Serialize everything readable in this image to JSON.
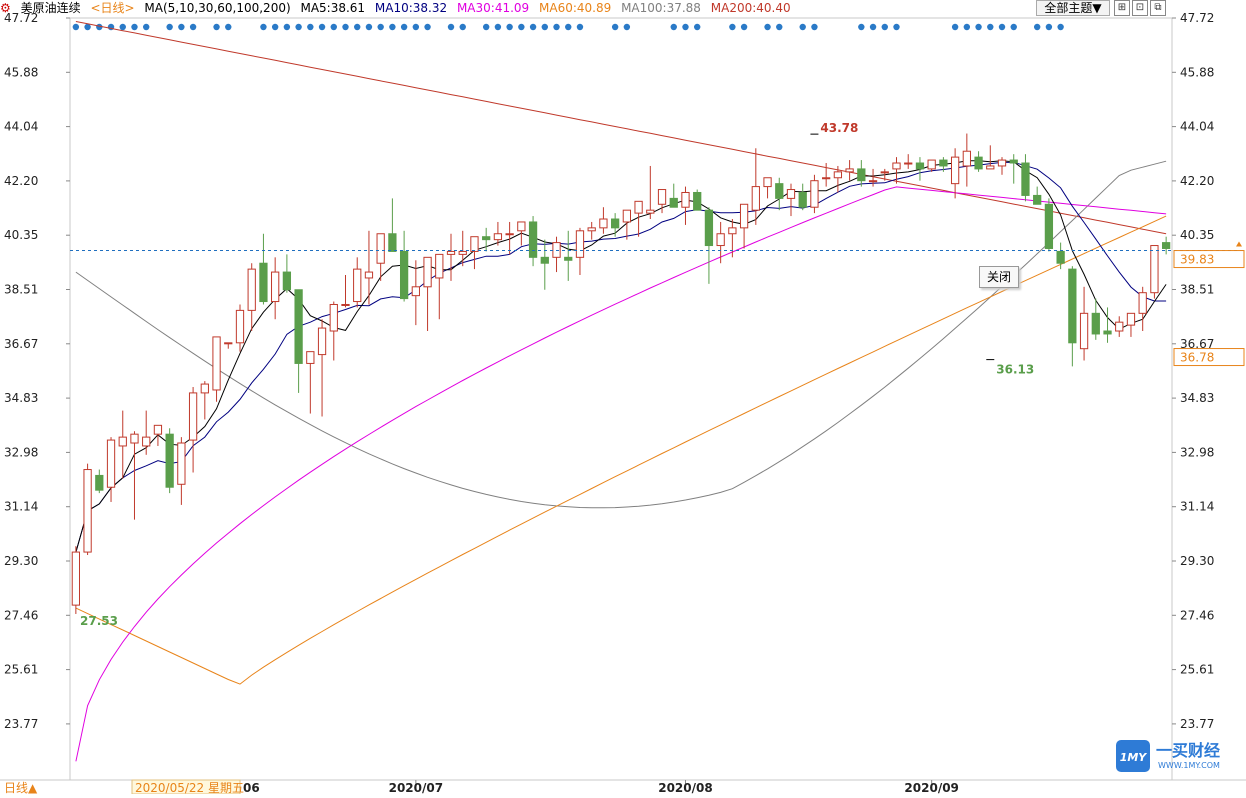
{
  "header": {
    "symbol": "美原油连续",
    "period_link": "<日线>",
    "ma_label": "MA(5,10,30,60,100,200)",
    "ma5": "MA5:38.61",
    "ma10": "MA10:38.32",
    "ma30": "MA30:41.09",
    "ma60": "MA60:40.89",
    "ma100": "MA100:37.88",
    "ma200": "MA200:40.40",
    "theme_button": "全部主题▼"
  },
  "overlay": {
    "close_label": "关闭",
    "high_label": "43.78",
    "low_label": "36.13",
    "start_low_label": "27.53",
    "price_tag_current": "39.83",
    "price_tag_ma": "36.78"
  },
  "footer": {
    "period_button": "日线▲",
    "cursor_date": "2020/05/22 星期五",
    "cursor_tail": "06"
  },
  "logo": {
    "name": "一买财经",
    "url": "WWW.1MY.COM",
    "badge": "1MY"
  },
  "colors": {
    "up": "#c0392b",
    "down": "#5a9e4b",
    "ma5": "#000000",
    "ma10": "#000080",
    "ma30": "#e000e0",
    "ma60": "#e8841a",
    "ma100": "#808080",
    "ma200": "#c0392b",
    "dash": "#1f6fbf"
  },
  "chart_data": {
    "type": "candlestick",
    "title": "美原油连续",
    "y_ticks": [
      "47.72",
      "45.88",
      "44.04",
      "42.20",
      "40.35",
      "38.51",
      "36.67",
      "34.83",
      "32.98",
      "31.14",
      "29.30",
      "27.46",
      "25.61",
      "23.77"
    ],
    "ylim": [
      22.5,
      47.72
    ],
    "x_labels": [
      {
        "label": "2020/07",
        "index": 29
      },
      {
        "label": "2020/08",
        "index": 52
      },
      {
        "label": "2020/09",
        "index": 73
      }
    ],
    "current_price": 39.83,
    "high_marker": {
      "index": 63,
      "value": 43.78
    },
    "low_marker": {
      "index": 78,
      "value": 36.13
    },
    "start_marker": {
      "index": 0,
      "value": 27.53
    },
    "candles": [
      [
        27.8,
        29.8,
        27.5,
        29.6
      ],
      [
        29.6,
        32.6,
        29.5,
        32.4
      ],
      [
        32.2,
        32.4,
        31.6,
        31.7
      ],
      [
        31.8,
        33.5,
        31.3,
        33.4
      ],
      [
        33.2,
        34.4,
        32.1,
        33.5
      ],
      [
        33.3,
        33.7,
        30.7,
        33.6
      ],
      [
        33.2,
        34.4,
        32.9,
        33.5
      ],
      [
        33.6,
        33.9,
        33.2,
        33.9
      ],
      [
        33.6,
        33.8,
        31.6,
        31.8
      ],
      [
        31.9,
        33.5,
        31.2,
        33.3
      ],
      [
        33.4,
        35.2,
        32.3,
        35.0
      ],
      [
        35.0,
        35.4,
        34.1,
        35.3
      ],
      [
        35.1,
        36.9,
        34.7,
        36.9
      ],
      [
        36.7,
        36.7,
        36.5,
        36.7
      ],
      [
        36.7,
        38.0,
        36.4,
        37.8
      ],
      [
        37.8,
        39.4,
        37.1,
        39.2
      ],
      [
        39.4,
        40.4,
        38.0,
        38.1
      ],
      [
        38.1,
        39.6,
        37.5,
        39.1
      ],
      [
        39.1,
        39.7,
        38.4,
        38.5
      ],
      [
        38.5,
        38.5,
        35.0,
        36.0
      ],
      [
        36.0,
        36.3,
        34.3,
        36.4
      ],
      [
        36.3,
        37.5,
        34.2,
        37.2
      ],
      [
        37.1,
        38.1,
        36.1,
        38.0
      ],
      [
        38.0,
        39.0,
        37.9,
        38.0
      ],
      [
        38.1,
        39.6,
        37.9,
        39.2
      ],
      [
        38.9,
        40.5,
        38.0,
        39.1
      ],
      [
        39.4,
        40.4,
        38.8,
        40.4
      ],
      [
        40.4,
        41.6,
        40.0,
        39.8
      ],
      [
        39.8,
        40.5,
        38.1,
        38.2
      ],
      [
        38.3,
        39.5,
        37.3,
        38.6
      ],
      [
        38.6,
        38.9,
        37.1,
        39.6
      ],
      [
        38.9,
        39.6,
        37.5,
        39.7
      ],
      [
        39.7,
        40.4,
        38.8,
        39.8
      ],
      [
        39.7,
        40.5,
        39.3,
        39.8
      ],
      [
        39.8,
        40.1,
        39.2,
        40.3
      ],
      [
        40.3,
        40.6,
        39.8,
        40.2
      ],
      [
        40.2,
        40.8,
        40.0,
        40.4
      ],
      [
        40.4,
        40.8,
        39.7,
        40.4
      ],
      [
        40.5,
        40.7,
        40.0,
        40.8
      ],
      [
        40.8,
        41.0,
        39.3,
        39.6
      ],
      [
        39.6,
        40.2,
        38.5,
        39.4
      ],
      [
        39.6,
        40.3,
        39.1,
        40.1
      ],
      [
        39.6,
        40.5,
        38.8,
        39.5
      ],
      [
        39.6,
        40.6,
        39.0,
        40.5
      ],
      [
        40.5,
        40.8,
        40.2,
        40.6
      ],
      [
        40.6,
        41.3,
        40.4,
        40.9
      ],
      [
        40.9,
        41.1,
        40.3,
        40.6
      ],
      [
        40.8,
        41.2,
        40.2,
        41.2
      ],
      [
        41.1,
        41.2,
        40.3,
        41.5
      ],
      [
        41.1,
        42.7,
        40.9,
        41.2
      ],
      [
        41.4,
        41.9,
        41.1,
        41.9
      ],
      [
        41.6,
        42.1,
        41.3,
        41.3
      ],
      [
        41.3,
        42.0,
        40.7,
        41.8
      ],
      [
        41.8,
        41.9,
        41.2,
        41.2
      ],
      [
        41.2,
        41.3,
        38.7,
        40.0
      ],
      [
        40.0,
        40.8,
        39.4,
        40.4
      ],
      [
        40.4,
        40.9,
        39.6,
        40.6
      ],
      [
        40.6,
        41.4,
        39.9,
        41.4
      ],
      [
        41.2,
        43.3,
        40.7,
        42.0
      ],
      [
        42.0,
        42.3,
        41.6,
        42.3
      ],
      [
        42.1,
        42.3,
        41.2,
        41.6
      ],
      [
        41.6,
        42.1,
        41.0,
        41.9
      ],
      [
        41.8,
        42.1,
        41.2,
        41.3
      ],
      [
        41.3,
        42.4,
        41.1,
        42.2
      ],
      [
        42.3,
        42.8,
        42.0,
        42.3
      ]
    ],
    "candles_tail": [
      [
        42.3,
        42.7,
        41.8,
        42.5
      ],
      [
        42.5,
        42.9,
        42.2,
        42.6
      ],
      [
        42.6,
        42.9,
        42.0,
        42.2
      ],
      [
        42.2,
        42.6,
        42.0,
        42.2
      ],
      [
        42.5,
        42.6,
        42.2,
        42.5
      ],
      [
        42.6,
        43.0,
        42.1,
        42.8
      ],
      [
        42.8,
        43.1,
        42.6,
        42.8
      ],
      [
        42.8,
        43.0,
        42.2,
        42.6
      ],
      [
        42.6,
        42.9,
        42.5,
        42.9
      ],
      [
        42.9,
        43.0,
        42.5,
        42.7
      ],
      [
        42.1,
        43.3,
        41.6,
        43.0
      ],
      [
        42.7,
        43.8,
        42.0,
        43.2
      ],
      [
        43.0,
        43.2,
        42.5,
        42.6
      ],
      [
        42.6,
        43.4,
        42.6,
        42.7
      ],
      [
        42.7,
        43.0,
        42.4,
        42.9
      ],
      [
        42.9,
        43.1,
        42.1,
        42.8
      ],
      [
        42.8,
        43.1,
        41.5,
        41.7
      ],
      [
        41.7,
        42.0,
        41.4,
        41.4
      ],
      [
        41.4,
        41.6,
        39.8,
        39.9
      ],
      [
        39.8,
        40.1,
        39.2,
        39.4
      ],
      [
        39.2,
        39.3,
        35.9,
        36.7
      ],
      [
        36.5,
        38.6,
        36.1,
        37.7
      ],
      [
        37.7,
        38.2,
        36.8,
        37.0
      ],
      [
        37.1,
        37.9,
        36.7,
        37.0
      ],
      [
        37.1,
        37.6,
        36.9,
        37.4
      ],
      [
        37.3,
        37.6,
        36.9,
        37.7
      ],
      [
        37.7,
        38.6,
        37.1,
        38.4
      ],
      [
        38.4,
        39.8,
        38.2,
        40.0
      ],
      [
        40.1,
        40.3,
        39.7,
        39.9
      ]
    ]
  }
}
